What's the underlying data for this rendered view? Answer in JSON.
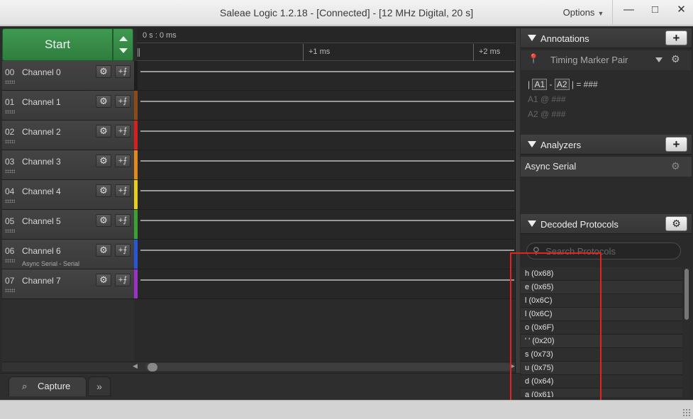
{
  "window": {
    "title": "Saleae Logic 1.2.18 - [Connected] - [12 MHz Digital, 20 s]",
    "options_label": "Options",
    "minimize_symbol": "—",
    "maximize_symbol": "□",
    "close_symbol": "✕"
  },
  "capture": {
    "start_label": "Start"
  },
  "timeline": {
    "cursor_time": "0 s : 0 ms",
    "tick_1": "+1 ms",
    "tick_2": "+2 ms"
  },
  "channels": [
    {
      "num": "00",
      "name": "Channel 0",
      "sub": "",
      "color": "#1e1e1e"
    },
    {
      "num": "01",
      "name": "Channel 1",
      "sub": "",
      "color": "#8a4a1a"
    },
    {
      "num": "02",
      "name": "Channel 2",
      "sub": "",
      "color": "#d42020"
    },
    {
      "num": "03",
      "name": "Channel 3",
      "sub": "",
      "color": "#e08a1c"
    },
    {
      "num": "04",
      "name": "Channel 4",
      "sub": "",
      "color": "#e6cf1a"
    },
    {
      "num": "05",
      "name": "Channel 5",
      "sub": "",
      "color": "#3da032"
    },
    {
      "num": "06",
      "name": "Channel 6",
      "sub": "Async Serial - Serial",
      "color": "#2a55d8"
    },
    {
      "num": "07",
      "name": "Channel 7",
      "sub": "",
      "color": "#9a32c8"
    }
  ],
  "channel_buttons": {
    "gear": "⚙",
    "add_analyzer": "+⨍"
  },
  "tabs": {
    "capture": "Capture",
    "more": "»"
  },
  "annotations": {
    "title": "Annotations",
    "add": "+",
    "timing_pair": "Timing Marker Pair",
    "line1_prefix": "|",
    "a1": "A1",
    "dash": "-",
    "a2": "A2",
    "line1_suffix": "| = ###",
    "line2": "A1  @  ###",
    "line3": "A2  @  ###"
  },
  "analyzers": {
    "title": "Analyzers",
    "add": "+",
    "items": [
      "Async Serial"
    ]
  },
  "decoded": {
    "title": "Decoded Protocols",
    "search_placeholder": "Search Protocols",
    "items": [
      "h (0x68)",
      "e (0x65)",
      "l (0x6C)",
      "l (0x6C)",
      "o (0x6F)",
      "' ' (0x20)",
      "s (0x73)",
      "u (0x75)",
      "d (0x64)",
      "a (0x61)"
    ]
  },
  "colors": {
    "start_green": "#3f9a50",
    "highlight_red": "#e3231c"
  }
}
